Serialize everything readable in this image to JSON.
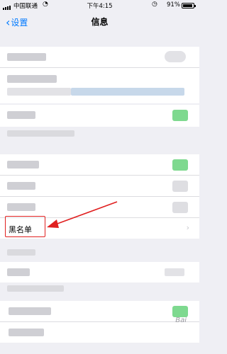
{
  "status_bar": {
    "carrier": "中国联通",
    "time": "下午4:15",
    "battery_percent": "91%",
    "battery_level": 0.91
  },
  "nav": {
    "back_label": "设置",
    "title": "信息"
  },
  "blacklist_row": {
    "label": "黑名单"
  },
  "watermark": "Bai"
}
